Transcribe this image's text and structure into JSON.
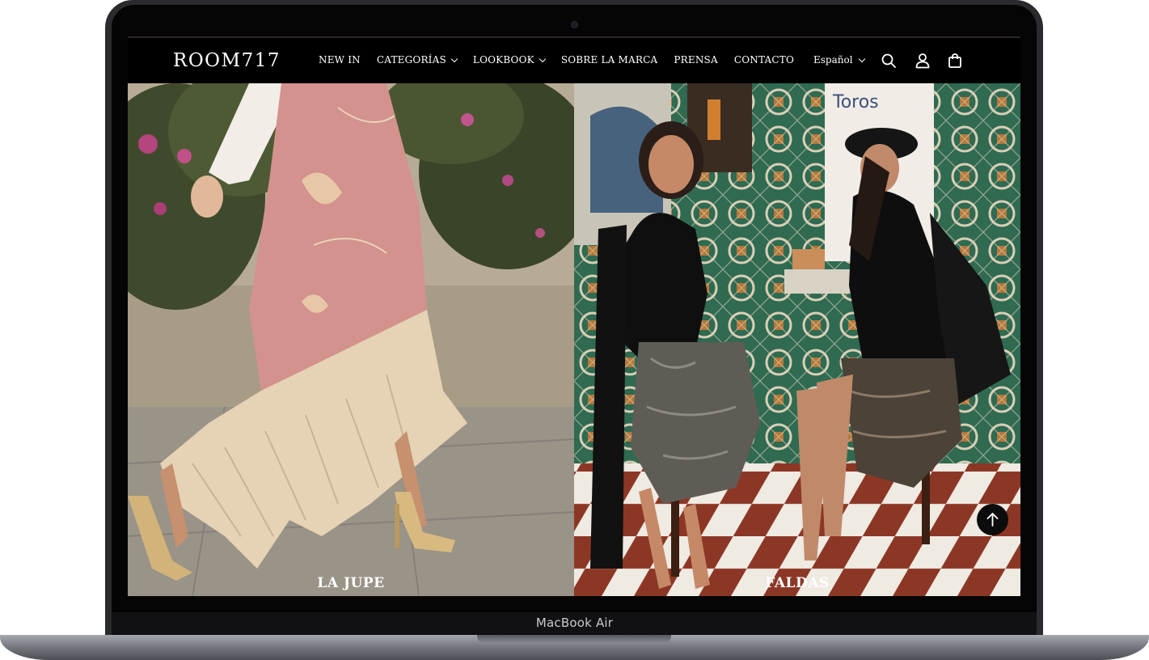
{
  "device": {
    "label": "MacBook Air"
  },
  "header": {
    "logo": "ROOM717",
    "nav": [
      {
        "label": "NEW IN",
        "has_dropdown": false
      },
      {
        "label": "CATEGORÍAS",
        "has_dropdown": true
      },
      {
        "label": "LOOKBOOK",
        "has_dropdown": true
      },
      {
        "label": "SOBRE LA MARCA",
        "has_dropdown": false
      },
      {
        "label": "PRENSA",
        "has_dropdown": false
      },
      {
        "label": "CONTACTO",
        "has_dropdown": false
      }
    ],
    "language": "Español",
    "icons": [
      "search-icon",
      "user-icon",
      "shopping-bag-icon"
    ]
  },
  "panels": [
    {
      "caption": "LA JUPE"
    },
    {
      "caption": "FALDAS"
    }
  ],
  "colors": {
    "header_bg": "#000000",
    "text": "#ffffff",
    "skirt_pink": "#d3928e",
    "fringe": "#e6d2b4",
    "tile_green": "#3e7a60"
  },
  "scroll_top_icon": "arrow-up-icon"
}
